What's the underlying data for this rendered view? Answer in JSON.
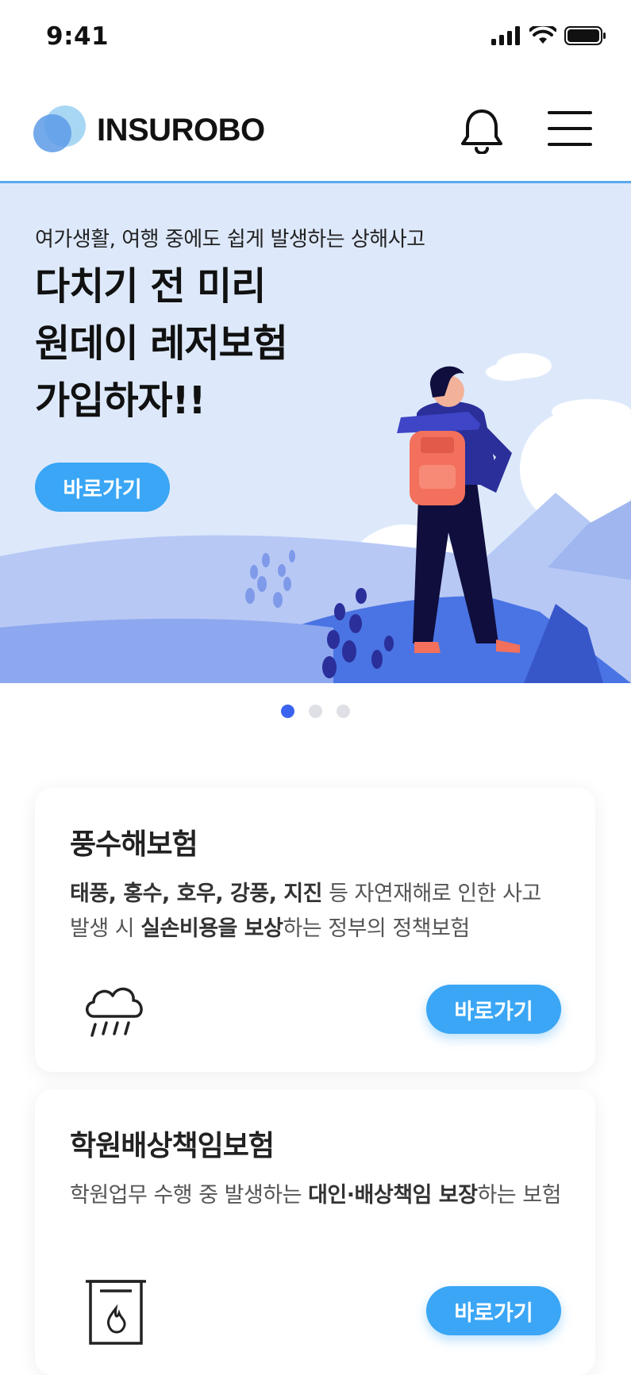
{
  "status_bar": {
    "time": "9:41"
  },
  "header": {
    "logo_text": "INSUROBO"
  },
  "banner": {
    "subtitle": "여가생활, 여행 중에도 쉽게 발생하는 상해사고",
    "title_line1": "다치기 전 미리",
    "title_line2": "원데이 레저보험",
    "title_line3": "가입하자!!",
    "button_label": "바로가기"
  },
  "carousel": {
    "total": 3,
    "active": 1
  },
  "cards": [
    {
      "title": "풍수해보험",
      "desc_b1": "태풍, 홍수, 호우, 강풍, 지진",
      "desc_t1": " 등 자연재해로 인한 사고 발생 시 ",
      "desc_b2": "실손비용을 보상",
      "desc_t2": "하는 정부의 정책보험",
      "button_label": "바로가기",
      "icon": "rain-cloud-icon"
    },
    {
      "title": "학원배상책임보험",
      "desc_t0": "학원업무 수행 중 발생하는 ",
      "desc_b1": "대인·배상책임 보장",
      "desc_t1": "하는 보험",
      "button_label": "바로가기",
      "icon": "fire-extinguisher-box-icon"
    }
  ],
  "colors": {
    "accent": "#3aa6f5",
    "dot_active": "#3b63f0",
    "banner_bg": "#dde9fb"
  }
}
